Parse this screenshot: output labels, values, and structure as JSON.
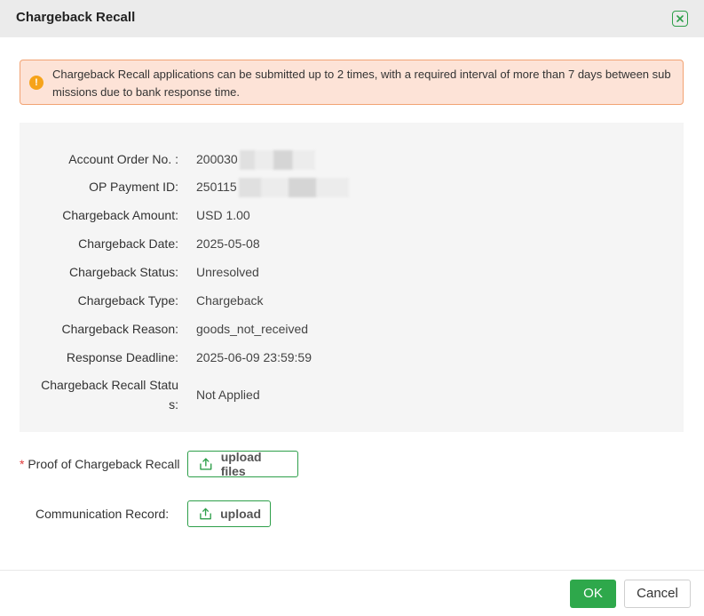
{
  "dialog": {
    "title": "Chargeback Recall"
  },
  "alert": {
    "text": "Chargeback Recall applications can be submitted up to 2 times, with a required interval of more than 7 days between submissions due to bank response time."
  },
  "details": [
    {
      "label": "Account Order No. :",
      "value": "200030"
    },
    {
      "label": "OP Payment ID:",
      "value": "250115"
    },
    {
      "label": "Chargeback Amount:",
      "value": "USD 1.00"
    },
    {
      "label": "Chargeback Date:",
      "value": "2025-05-08"
    },
    {
      "label": "Chargeback Status:",
      "value": "Unresolved"
    },
    {
      "label": "Chargeback Type:",
      "value": "Chargeback"
    },
    {
      "label": "Chargeback Reason:",
      "value": "goods_not_received"
    },
    {
      "label": "Response Deadline:",
      "value": "2025-06-09 23:59:59"
    },
    {
      "label": "Chargeback Recall Status:",
      "value": "Not Applied"
    }
  ],
  "form": {
    "proof_required_mark": "*",
    "proof_label": "Proof of Chargeback Recall",
    "proof_button": "upload files",
    "communication_label": "Communication Record:",
    "communication_button": "upload"
  },
  "footer": {
    "ok_label": "OK",
    "cancel_label": "Cancel"
  },
  "colors": {
    "accent": "#2ea84b",
    "alert_bg": "#fde3d7",
    "alert_border": "#f2a373",
    "warning_icon": "#f6a31a"
  }
}
